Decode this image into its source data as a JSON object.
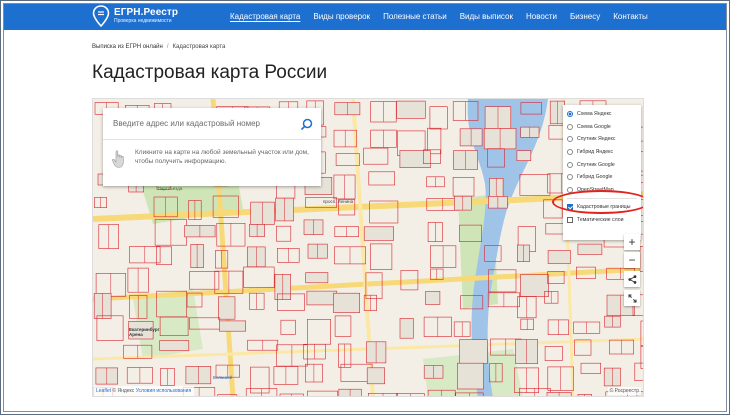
{
  "header": {
    "logo_title": "ЕГРН.Реестр",
    "logo_subtitle": "Проверка недвижимости",
    "nav": [
      {
        "label": "Кадастровая карта",
        "active": true
      },
      {
        "label": "Виды проверок"
      },
      {
        "label": "Полезные статьи"
      },
      {
        "label": "Виды выписок"
      },
      {
        "label": "Новости"
      },
      {
        "label": "Бизнесу"
      },
      {
        "label": "Контакты"
      }
    ],
    "brand_color": "#1d6fd0"
  },
  "breadcrumb": {
    "home": "Выписка из ЕГРН онлайн",
    "separator": "/",
    "current": "Кадастровая карта"
  },
  "page_title": "Кадастровая карта России",
  "map": {
    "search_placeholder": "Введите адрес или кадастровый номер",
    "hint_text": "Кликните на карте на любой земельный участок или дом, чтобы получить информацию.",
    "layers": [
      {
        "label": "Схема Яндекс",
        "selected": true
      },
      {
        "label": "Схема Google"
      },
      {
        "label": "Спутник Яндекс"
      },
      {
        "label": "Гибрид Яндекс"
      },
      {
        "label": "Спутник Google"
      },
      {
        "label": "Гибрид Google"
      },
      {
        "label": "OpenStreetMap"
      }
    ],
    "overlays": [
      {
        "label": "Кадастровые границы",
        "checked": true
      },
      {
        "label": "Тематические слои",
        "checked": false
      }
    ],
    "highlight_color": "#e2221d",
    "cadastral_color": "#d9232d",
    "labels": {
      "park": "парк ХХII Партсъезда",
      "arena": "Екатеринбург Арена",
      "street": "просп. Ленина",
      "bolshoy": "Большой"
    },
    "zoom_in": "+",
    "zoom_out": "−",
    "attribution_leaflet": "Leaflet",
    "attribution_yandex": "© Яндекс",
    "attribution_terms": "Условия использования",
    "attribution_right": "© Росреестр"
  }
}
